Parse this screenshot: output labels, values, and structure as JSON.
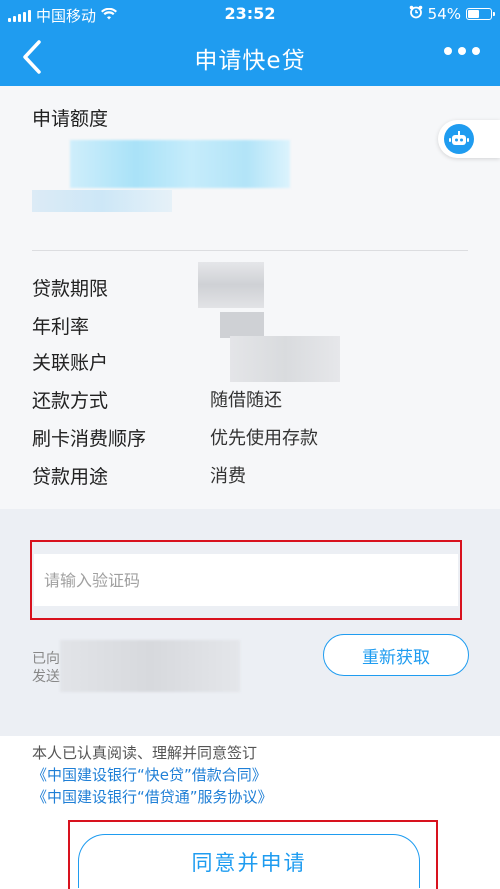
{
  "status_bar": {
    "carrier": "中国移动",
    "time": "23:52",
    "battery_text": "54%",
    "battery_level": 0.54
  },
  "nav": {
    "title": "申请快e贷"
  },
  "amount": {
    "label": "申请额度"
  },
  "details": {
    "loan_term_label": "贷款期限",
    "annual_rate_label": "年利率",
    "linked_account_label": "关联账户",
    "repayment_label": "还款方式",
    "repayment_value": "随借随还",
    "card_order_label": "刷卡消费顺序",
    "card_order_value": "优先使用存款",
    "purpose_label": "贷款用途",
    "purpose_value": "消费"
  },
  "verify": {
    "placeholder": "请输入验证码",
    "sent_prefix_1": "已向",
    "sent_prefix_2": "发送",
    "resend_label": "重新获取"
  },
  "agreement": {
    "text": "本人已认真阅读、理解并同意签订",
    "contract_1": "《中国建设银行“快e贷”借款合同》",
    "contract_2": "《中国建设银行“借贷通”服务协议》"
  },
  "submit_label": "同意并申请",
  "colors": {
    "primary": "#1f9cf0",
    "highlight_border": "#d8121e",
    "link": "#1f7fd6"
  },
  "icons": [
    "back-icon",
    "more-icon",
    "robot-icon",
    "wifi-icon",
    "alarm-icon",
    "battery-icon"
  ]
}
